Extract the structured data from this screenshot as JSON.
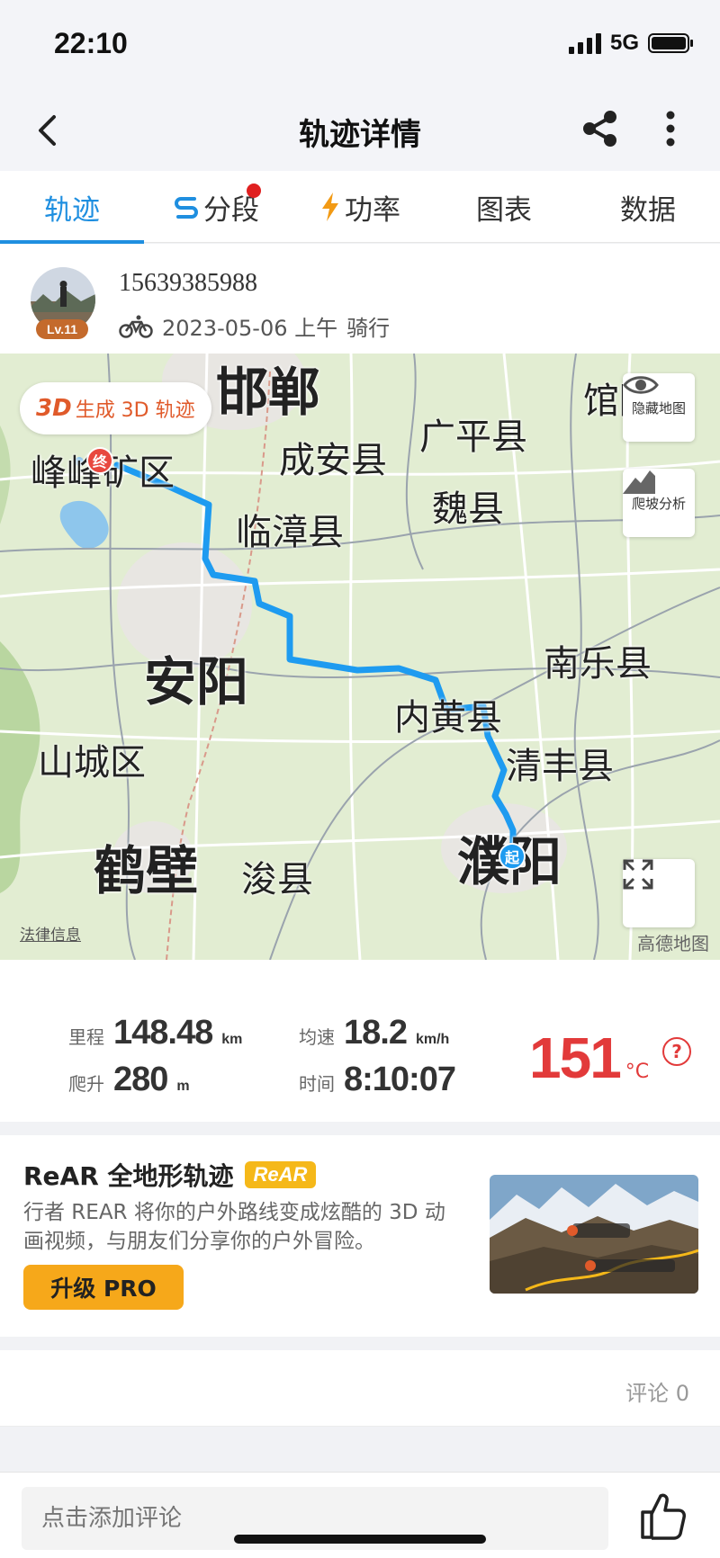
{
  "status_bar": {
    "time": "22:10",
    "network": "5G"
  },
  "nav": {
    "title": "轨迹详情",
    "icons": [
      "back-icon",
      "share-icon",
      "more-icon"
    ]
  },
  "tabs": [
    {
      "label": "轨迹",
      "active": true
    },
    {
      "label": "分段",
      "icon": "segment-icon",
      "has_dot": true
    },
    {
      "label": "功率",
      "icon": "lightning-icon"
    },
    {
      "label": "图表"
    },
    {
      "label": "数据"
    }
  ],
  "user": {
    "name": "15639385988",
    "level": "Lv.11",
    "date": "2023-05-06 上午",
    "activity": "骑行",
    "activity_icon": "bicycle-icon"
  },
  "map": {
    "btn_3d_prefix": "3D",
    "btn_3d_label": "生成 3D 轨迹",
    "hide_map_label": "隐藏地图",
    "climb_label": "爬坡分析",
    "start_marker": "起",
    "end_marker": "终",
    "legal": "法律信息",
    "provider": "高德地图",
    "places": {
      "handan": "邯郸",
      "guantao": "馆陶县",
      "guangping": "广平县",
      "chengan": "成安县",
      "fengfeng": "峰峰矿区",
      "linzhang": "临漳县",
      "weixian": "魏县",
      "anyang": "安阳",
      "nanle": "南乐县",
      "neihuang": "内黄县",
      "shancheng": "山城区",
      "qingfeng": "清丰县",
      "hebi": "鹤壁",
      "xunxian": "浚县",
      "puyang": "濮阳"
    },
    "route_color": "#1e9bf0"
  },
  "stats": {
    "distance_label": "里程",
    "distance": "148.48",
    "distance_unit": "km",
    "speed_label": "均速",
    "speed": "18.2",
    "speed_unit": "km/h",
    "climb_label": "爬升",
    "climb": "280",
    "climb_unit": "m",
    "time_label": "时间",
    "time": "8:10:07",
    "temperature": "151",
    "temperature_unit": "°C",
    "help": "?"
  },
  "promo": {
    "title": "ReAR 全地形轨迹",
    "badge": "ReAR",
    "description": "行者 REAR 将你的户外路线变成炫酷的 3D 动画视频，与朋友们分享你的户外冒险。",
    "button": "升级 PRO"
  },
  "comments": {
    "count_label": "评论 0",
    "input_placeholder": "点击添加评论",
    "like_icon": "thumbs-up-icon"
  },
  "colors": {
    "accent": "#1f8fe0",
    "temperature": "#e23a3a",
    "upgrade": "#f6a81a"
  }
}
